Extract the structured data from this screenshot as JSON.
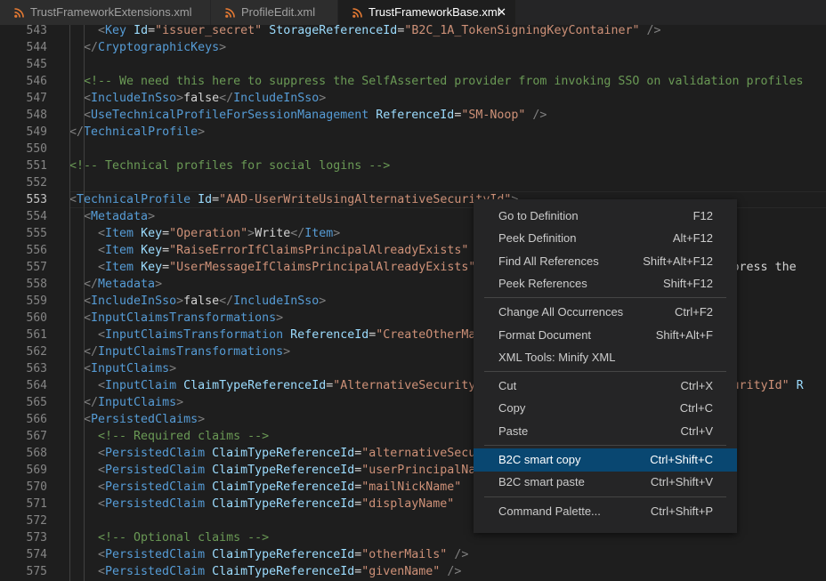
{
  "tabs": [
    {
      "label": "TrustFrameworkExtensions.xml",
      "active": false
    },
    {
      "label": "ProfileEdit.xml",
      "active": false
    },
    {
      "label": "TrustFrameworkBase.xml",
      "active": true,
      "close": "✕"
    }
  ],
  "icon_color": "#e37933",
  "current_line": "553",
  "lines": [
    {
      "num": "543",
      "indent": 2,
      "tokens": [
        [
          "t",
          "<"
        ],
        [
          "n",
          "Key"
        ],
        [
          "x",
          " "
        ],
        [
          "a",
          "Id"
        ],
        [
          "x",
          "="
        ],
        [
          "s",
          "\"issuer_secret\""
        ],
        [
          "x",
          " "
        ],
        [
          "a",
          "StorageReferenceId"
        ],
        [
          "x",
          "="
        ],
        [
          "s",
          "\"B2C_1A_TokenSigningKeyContainer\""
        ],
        [
          "x",
          " "
        ],
        [
          "t",
          "/>"
        ]
      ]
    },
    {
      "num": "544",
      "indent": 1,
      "tokens": [
        [
          "t",
          "</"
        ],
        [
          "n",
          "CryptographicKeys"
        ],
        [
          "t",
          ">"
        ]
      ]
    },
    {
      "num": "545",
      "indent": 0,
      "tokens": []
    },
    {
      "num": "546",
      "indent": 1,
      "tokens": [
        [
          "c",
          "<!-- We need this here to suppress the SelfAsserted provider from invoking SSO on validation profiles"
        ]
      ]
    },
    {
      "num": "547",
      "indent": 1,
      "tokens": [
        [
          "t",
          "<"
        ],
        [
          "n",
          "IncludeInSso"
        ],
        [
          "t",
          ">"
        ],
        [
          "x",
          "false"
        ],
        [
          "t",
          "</"
        ],
        [
          "n",
          "IncludeInSso"
        ],
        [
          "t",
          ">"
        ]
      ]
    },
    {
      "num": "548",
      "indent": 1,
      "tokens": [
        [
          "t",
          "<"
        ],
        [
          "n",
          "UseTechnicalProfileForSessionManagement"
        ],
        [
          "x",
          " "
        ],
        [
          "a",
          "ReferenceId"
        ],
        [
          "x",
          "="
        ],
        [
          "s",
          "\"SM-Noop\""
        ],
        [
          "x",
          " "
        ],
        [
          "t",
          "/>"
        ]
      ]
    },
    {
      "num": "549",
      "indent": 0,
      "tokens": [
        [
          "t",
          "</"
        ],
        [
          "n",
          "TechnicalProfile"
        ],
        [
          "t",
          ">"
        ]
      ]
    },
    {
      "num": "550",
      "indent": 0,
      "tokens": []
    },
    {
      "num": "551",
      "indent": 0,
      "tokens": [
        [
          "c",
          "<!-- Technical profiles for social logins -->"
        ]
      ]
    },
    {
      "num": "552",
      "indent": 0,
      "tokens": []
    },
    {
      "num": "553",
      "indent": 0,
      "tokens": [
        [
          "t",
          "<"
        ],
        [
          "n",
          "TechnicalProfile"
        ],
        [
          "x",
          " "
        ],
        [
          "a",
          "Id"
        ],
        [
          "x",
          "="
        ],
        [
          "s",
          "\"AAD-UserWriteUsingAlternativeSecurityId\""
        ],
        [
          "t",
          ">"
        ]
      ]
    },
    {
      "num": "554",
      "indent": 1,
      "tokens": [
        [
          "t",
          "<"
        ],
        [
          "n",
          "Metadata"
        ],
        [
          "t",
          ">"
        ]
      ]
    },
    {
      "num": "555",
      "indent": 2,
      "tokens": [
        [
          "t",
          "<"
        ],
        [
          "n",
          "Item"
        ],
        [
          "x",
          " "
        ],
        [
          "a",
          "Key"
        ],
        [
          "x",
          "="
        ],
        [
          "s",
          "\"Operation\""
        ],
        [
          "t",
          ">"
        ],
        [
          "x",
          "Write"
        ],
        [
          "t",
          "</"
        ],
        [
          "n",
          "Item"
        ],
        [
          "t",
          ">"
        ]
      ]
    },
    {
      "num": "556",
      "indent": 2,
      "tokens": [
        [
          "t",
          "<"
        ],
        [
          "n",
          "Item"
        ],
        [
          "x",
          " "
        ],
        [
          "a",
          "Key"
        ],
        [
          "x",
          "="
        ],
        [
          "s",
          "\"RaiseErrorIfClaimsPrincipalAlreadyExists\""
        ]
      ]
    },
    {
      "num": "557",
      "indent": 2,
      "tokens": [
        [
          "t",
          "<"
        ],
        [
          "n",
          "Item"
        ],
        [
          "x",
          " "
        ],
        [
          "a",
          "Key"
        ],
        [
          "x",
          "="
        ],
        [
          "s",
          "\"UserMessageIfClaimsPrincipalAlreadyExists\""
        ],
        [
          "x",
          "                                ase press the"
        ]
      ]
    },
    {
      "num": "558",
      "indent": 1,
      "tokens": [
        [
          "t",
          "</"
        ],
        [
          "n",
          "Metadata"
        ],
        [
          "t",
          ">"
        ]
      ]
    },
    {
      "num": "559",
      "indent": 1,
      "tokens": [
        [
          "t",
          "<"
        ],
        [
          "n",
          "IncludeInSso"
        ],
        [
          "t",
          ">"
        ],
        [
          "x",
          "false"
        ],
        [
          "t",
          "</"
        ],
        [
          "n",
          "IncludeInSso"
        ],
        [
          "t",
          ">"
        ]
      ]
    },
    {
      "num": "560",
      "indent": 1,
      "tokens": [
        [
          "t",
          "<"
        ],
        [
          "n",
          "InputClaimsTransformations"
        ],
        [
          "t",
          ">"
        ]
      ]
    },
    {
      "num": "561",
      "indent": 2,
      "tokens": [
        [
          "t",
          "<"
        ],
        [
          "n",
          "InputClaimsTransformation"
        ],
        [
          "x",
          " "
        ],
        [
          "a",
          "ReferenceId"
        ],
        [
          "x",
          "="
        ],
        [
          "s",
          "\"CreateOtherMailsFromEmail\""
        ]
      ]
    },
    {
      "num": "562",
      "indent": 1,
      "tokens": [
        [
          "t",
          "</"
        ],
        [
          "n",
          "InputClaimsTransformations"
        ],
        [
          "t",
          ">"
        ]
      ]
    },
    {
      "num": "563",
      "indent": 1,
      "tokens": [
        [
          "t",
          "<"
        ],
        [
          "n",
          "InputClaims"
        ],
        [
          "t",
          ">"
        ]
      ]
    },
    {
      "num": "564",
      "indent": 2,
      "tokens": [
        [
          "t",
          "<"
        ],
        [
          "n",
          "InputClaim"
        ],
        [
          "x",
          " "
        ],
        [
          "a",
          "ClaimTypeReferenceId"
        ],
        [
          "x",
          "="
        ],
        [
          "s",
          "\"AlternativeSecurityId\""
        ],
        [
          "x",
          " "
        ],
        [
          "a",
          "PartnerClaimType"
        ],
        [
          "x",
          "="
        ],
        [
          "s",
          "\"alternativeSecurityId\""
        ],
        [
          "x",
          " "
        ],
        [
          "a",
          "R"
        ]
      ]
    },
    {
      "num": "565",
      "indent": 1,
      "tokens": [
        [
          "t",
          "</"
        ],
        [
          "n",
          "InputClaims"
        ],
        [
          "t",
          ">"
        ]
      ]
    },
    {
      "num": "566",
      "indent": 1,
      "tokens": [
        [
          "t",
          "<"
        ],
        [
          "n",
          "PersistedClaims"
        ],
        [
          "t",
          ">"
        ]
      ]
    },
    {
      "num": "567",
      "indent": 2,
      "tokens": [
        [
          "c",
          "<!-- Required claims -->"
        ]
      ]
    },
    {
      "num": "568",
      "indent": 2,
      "tokens": [
        [
          "t",
          "<"
        ],
        [
          "n",
          "PersistedClaim"
        ],
        [
          "x",
          " "
        ],
        [
          "a",
          "ClaimTypeReferenceId"
        ],
        [
          "x",
          "="
        ],
        [
          "s",
          "\"alternativeSecurityId\""
        ]
      ]
    },
    {
      "num": "569",
      "indent": 2,
      "tokens": [
        [
          "t",
          "<"
        ],
        [
          "n",
          "PersistedClaim"
        ],
        [
          "x",
          " "
        ],
        [
          "a",
          "ClaimTypeReferenceId"
        ],
        [
          "x",
          "="
        ],
        [
          "s",
          "\"userPrincipalName\""
        ]
      ]
    },
    {
      "num": "570",
      "indent": 2,
      "tokens": [
        [
          "t",
          "<"
        ],
        [
          "n",
          "PersistedClaim"
        ],
        [
          "x",
          " "
        ],
        [
          "a",
          "ClaimTypeReferenceId"
        ],
        [
          "x",
          "="
        ],
        [
          "s",
          "\"mailNickName\""
        ]
      ]
    },
    {
      "num": "571",
      "indent": 2,
      "tokens": [
        [
          "t",
          "<"
        ],
        [
          "n",
          "PersistedClaim"
        ],
        [
          "x",
          " "
        ],
        [
          "a",
          "ClaimTypeReferenceId"
        ],
        [
          "x",
          "="
        ],
        [
          "s",
          "\"displayName\""
        ]
      ]
    },
    {
      "num": "572",
      "indent": 0,
      "tokens": []
    },
    {
      "num": "573",
      "indent": 2,
      "tokens": [
        [
          "c",
          "<!-- Optional claims -->"
        ]
      ]
    },
    {
      "num": "574",
      "indent": 2,
      "tokens": [
        [
          "t",
          "<"
        ],
        [
          "n",
          "PersistedClaim"
        ],
        [
          "x",
          " "
        ],
        [
          "a",
          "ClaimTypeReferenceId"
        ],
        [
          "x",
          "="
        ],
        [
          "s",
          "\"otherMails\""
        ],
        [
          "x",
          " "
        ],
        [
          "t",
          "/>"
        ]
      ]
    },
    {
      "num": "575",
      "indent": 2,
      "tokens": [
        [
          "t",
          "<"
        ],
        [
          "n",
          "PersistedClaim"
        ],
        [
          "x",
          " "
        ],
        [
          "a",
          "ClaimTypeReferenceId"
        ],
        [
          "x",
          "="
        ],
        [
          "s",
          "\"givenName\""
        ],
        [
          "x",
          " "
        ],
        [
          "t",
          "/>"
        ]
      ]
    }
  ],
  "context_menu": {
    "groups": [
      [
        {
          "label": "Go to Definition",
          "key": "F12",
          "name": "go-to-definition"
        },
        {
          "label": "Peek Definition",
          "key": "Alt+F12",
          "name": "peek-definition"
        },
        {
          "label": "Find All References",
          "key": "Shift+Alt+F12",
          "name": "find-all-references"
        },
        {
          "label": "Peek References",
          "key": "Shift+F12",
          "name": "peek-references"
        }
      ],
      [
        {
          "label": "Change All Occurrences",
          "key": "Ctrl+F2",
          "name": "change-all-occurrences"
        },
        {
          "label": "Format Document",
          "key": "Shift+Alt+F",
          "name": "format-document"
        },
        {
          "label": "XML Tools: Minify XML",
          "key": "",
          "name": "xml-tools-minify"
        }
      ],
      [
        {
          "label": "Cut",
          "key": "Ctrl+X",
          "name": "cut"
        },
        {
          "label": "Copy",
          "key": "Ctrl+C",
          "name": "copy"
        },
        {
          "label": "Paste",
          "key": "Ctrl+V",
          "name": "paste"
        }
      ],
      [
        {
          "label": "B2C smart copy",
          "key": "Ctrl+Shift+C",
          "name": "b2c-smart-copy",
          "highlighted": true
        },
        {
          "label": "B2C smart paste",
          "key": "Ctrl+Shift+V",
          "name": "b2c-smart-paste"
        }
      ],
      [
        {
          "label": "Command Palette...",
          "key": "Ctrl+Shift+P",
          "name": "command-palette"
        }
      ]
    ]
  }
}
